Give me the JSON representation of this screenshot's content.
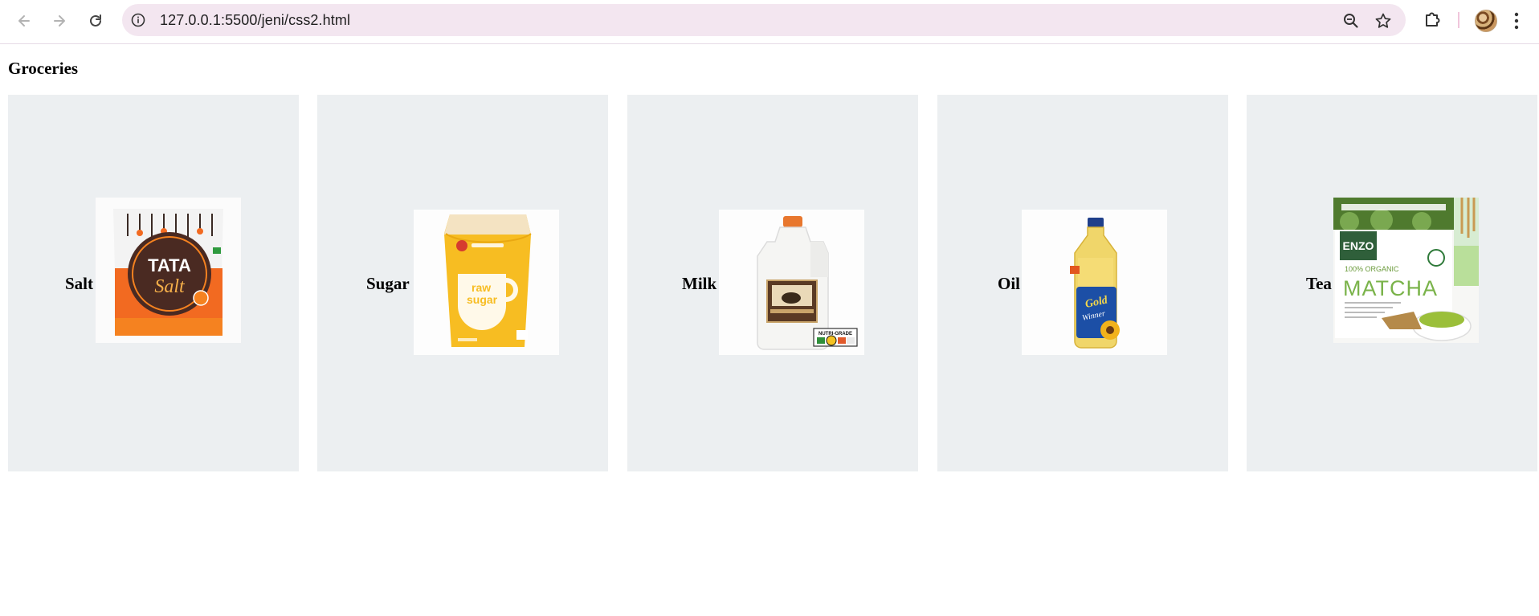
{
  "browser": {
    "url": "127.0.0.1:5500/jeni/css2.html",
    "icons": {
      "back": "arrow-left-icon",
      "forward": "arrow-right-icon",
      "reload": "reload-icon",
      "site_info": "info-icon",
      "zoom": "zoom-out-icon",
      "bookmark": "star-icon",
      "extensions": "puzzle-icon",
      "menu": "kebab-menu-icon"
    }
  },
  "page": {
    "title": "Groceries",
    "items": [
      {
        "label": "Salt",
        "image": "tata-salt-package",
        "packaging_text": "TATA Salt"
      },
      {
        "label": "Sugar",
        "image": "raw-sugar-bag",
        "packaging_text": "raw sugar"
      },
      {
        "label": "Milk",
        "image": "milk-jug",
        "packaging_text": "NUTRI-GRADE"
      },
      {
        "label": "Oil",
        "image": "sunflower-oil-bottle",
        "packaging_text": "Gold Winner"
      },
      {
        "label": "Tea",
        "image": "matcha-tea-pouch",
        "packaging_text": "ENZO 100% ORGANIC MATCHA"
      }
    ]
  },
  "colors": {
    "card_background": "#eceff1",
    "omnibox_background": "#f3e6f0"
  }
}
